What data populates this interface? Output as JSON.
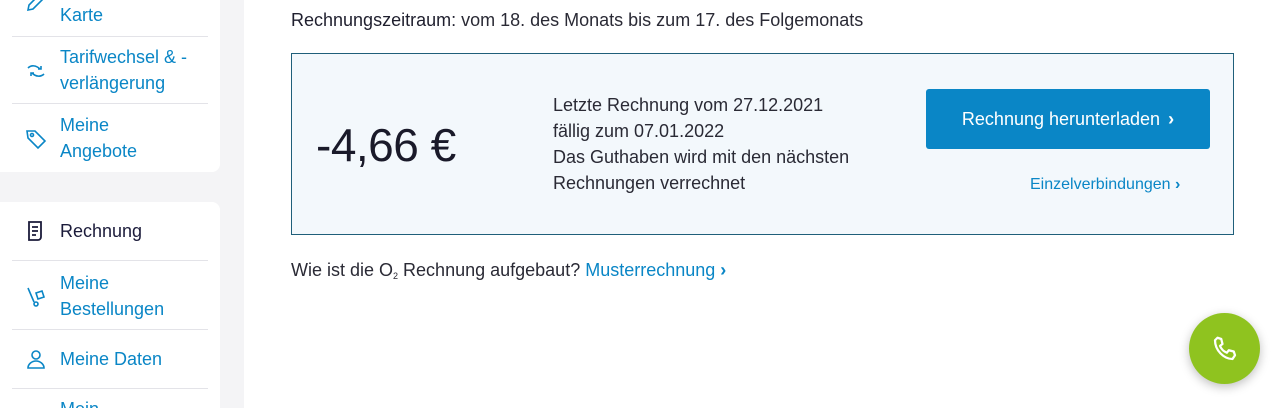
{
  "sidebar": {
    "items": [
      {
        "label": "Karte",
        "icon": "pencil-icon"
      },
      {
        "label": "Tarifwechsel & -\nverlängerung",
        "icon": "swap-arrows-icon"
      },
      {
        "label": "Meine\nAngebote",
        "icon": "tag-icon"
      },
      {
        "label": "Rechnung",
        "icon": "invoice-icon",
        "active": true
      },
      {
        "label": "Meine\nBestellungen",
        "icon": "hand-truck-icon"
      },
      {
        "label": "Meine Daten",
        "icon": "person-icon"
      },
      {
        "label": "Mein",
        "icon": ""
      }
    ]
  },
  "main": {
    "period_label": "Rechnungszeitraum:",
    "period_value": " vom 18. des Monats bis zum 17. des Folgemonats",
    "bill": {
      "amount": "-4,66 €",
      "line1": "Letzte Rechnung vom 27.12.2021",
      "line2": "fällig zum 07.01.2022",
      "line3": "Das Guthaben wird mit den nächsten Rechnungen verrechnet",
      "download_label": "Rechnung herunterladen",
      "calls_label": "Einzelverbindungen"
    },
    "faq_prefix": "Wie ist die O",
    "faq_sub": "2",
    "faq_middle": " Rechnung aufgebaut? ",
    "faq_link": "Musterrechnung"
  },
  "colors": {
    "accent": "#0a86c6",
    "box_border": "#1f5f7a",
    "fab": "#8fc31f"
  }
}
